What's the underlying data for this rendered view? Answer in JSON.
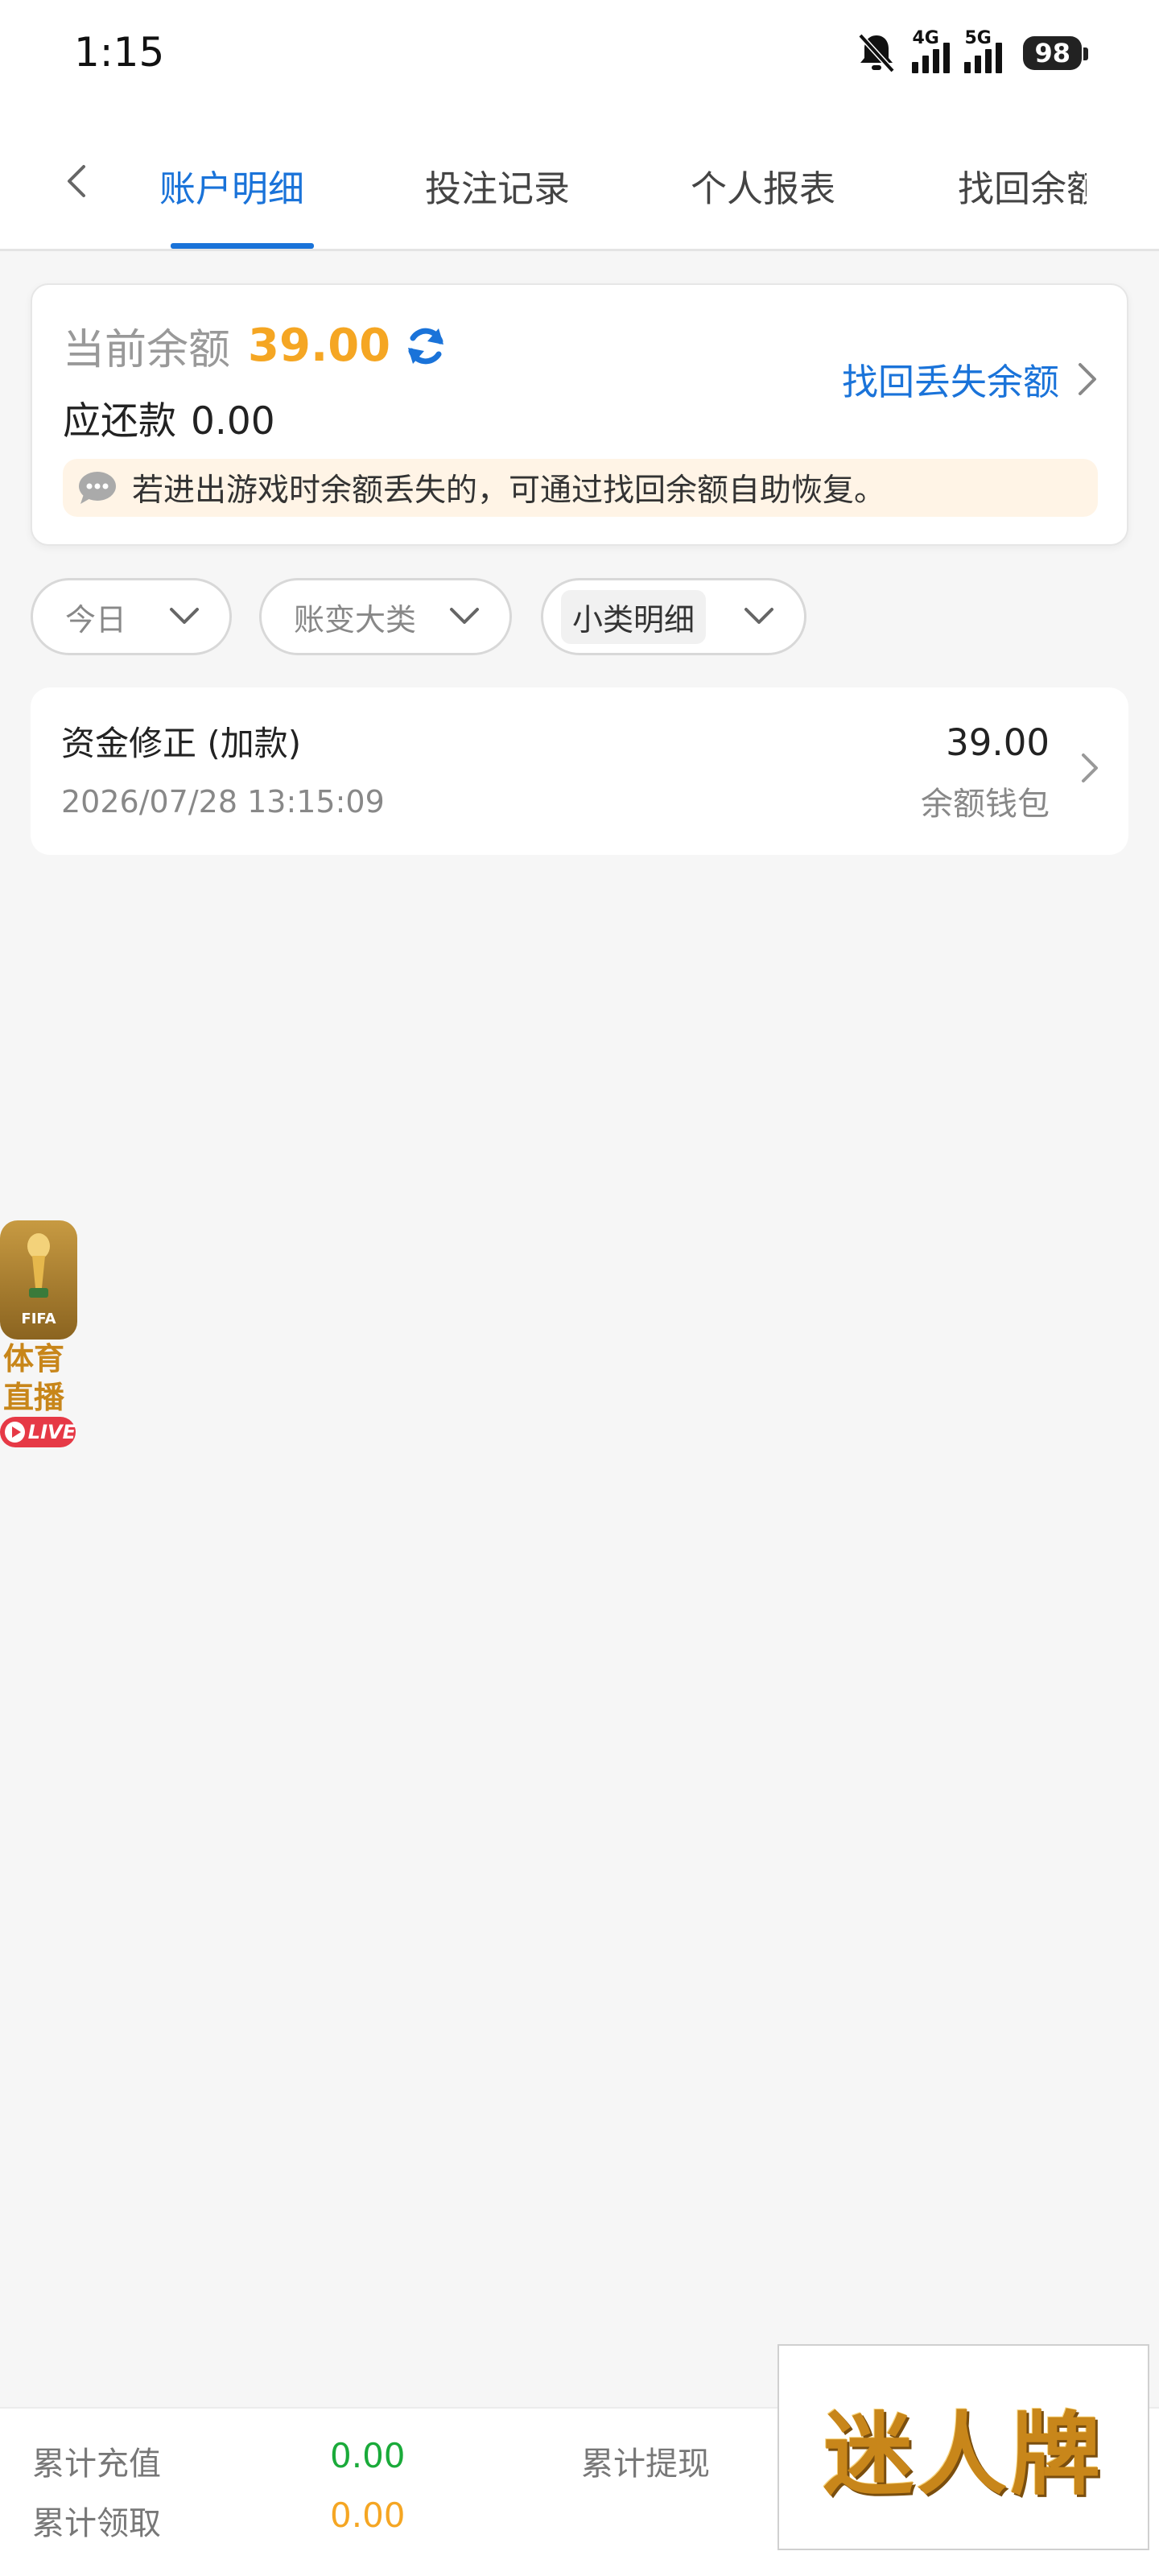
{
  "status_bar": {
    "time": "1:15",
    "net_4g": "4G",
    "net_5g": "5G",
    "battery": "98"
  },
  "tabs": [
    {
      "label": "账户明细",
      "active": true
    },
    {
      "label": "投注记录",
      "active": false
    },
    {
      "label": "个人报表",
      "active": false
    },
    {
      "label": "找回余额",
      "active": false
    }
  ],
  "balance": {
    "label": "当前余额",
    "value": "39.00",
    "owe_label": "应还款",
    "owe_value": "0.00",
    "recover_link": "找回丢失余额",
    "notice": "若进出游戏时余额丢失的，可通过找回余额自助恢复。"
  },
  "filters": [
    {
      "label": "今日"
    },
    {
      "label": "账变大类"
    },
    {
      "label": "小类明细"
    }
  ],
  "records": [
    {
      "title": "资金修正 (加款)",
      "time": "2026/07/28 13:15:09",
      "amount": "39.00",
      "wallet": "余额钱包"
    }
  ],
  "live_badge": {
    "fifa": "FIFA",
    "line1": "体育",
    "line2": "直播",
    "live": "LIVE"
  },
  "summary": {
    "recharge_label": "累计充值",
    "recharge_value": "0.00",
    "withdraw_label": "累计提现",
    "claim_label": "累计领取",
    "claim_value": "0.00"
  },
  "brand": {
    "text": "迷人牌"
  },
  "colors": {
    "accent": "#1a73d9",
    "balance": "#f5a623",
    "green": "#1aaa3a"
  }
}
